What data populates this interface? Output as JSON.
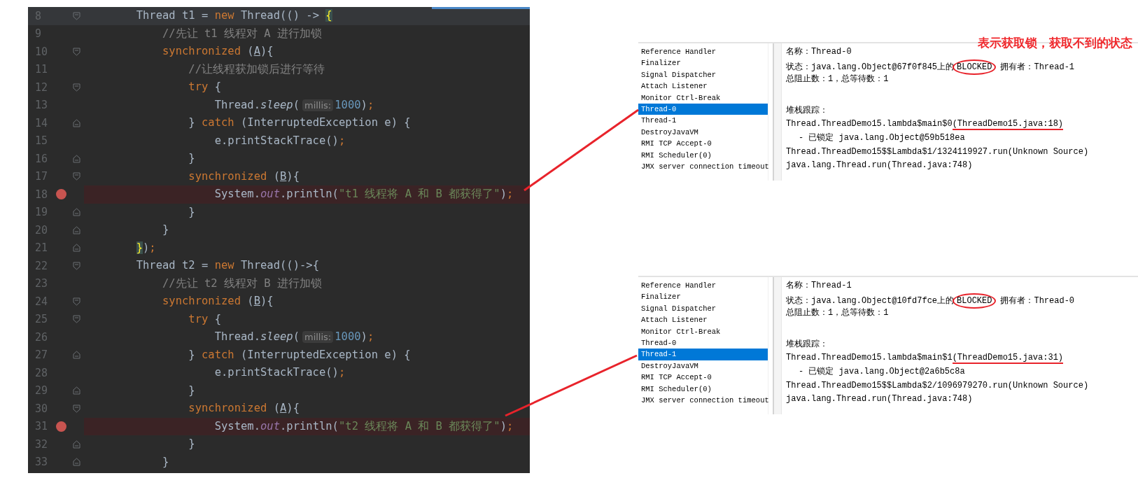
{
  "editor": {
    "lines": [
      {
        "number": "8",
        "current": true,
        "breakpoint": false,
        "fold_start": true,
        "fold_end": false,
        "tokens": [
          {
            "kind": "plain",
            "text": "        Thread t1 = "
          },
          {
            "kind": "keyword",
            "text": "new"
          },
          {
            "kind": "plain",
            "text": " Thread(() -> "
          },
          {
            "kind": "brace",
            "text": "{"
          }
        ]
      },
      {
        "number": "9",
        "current": false,
        "breakpoint": false,
        "fold_start": false,
        "fold_end": false,
        "tokens": [
          {
            "kind": "comment",
            "text": "            //先让 t1 线程对 A 进行加锁"
          }
        ]
      },
      {
        "number": "10",
        "current": false,
        "breakpoint": false,
        "fold_start": true,
        "fold_end": false,
        "tokens": [
          {
            "kind": "keyword",
            "text": "            synchronized"
          },
          {
            "kind": "plain",
            "text": " ("
          },
          {
            "kind": "ref",
            "text": "A"
          },
          {
            "kind": "plain",
            "text": "){"
          }
        ]
      },
      {
        "number": "11",
        "current": false,
        "breakpoint": false,
        "fold_start": false,
        "fold_end": false,
        "tokens": [
          {
            "kind": "comment",
            "text": "                //让线程获加锁后进行等待"
          }
        ]
      },
      {
        "number": "12",
        "current": false,
        "breakpoint": false,
        "fold_start": true,
        "fold_end": false,
        "tokens": [
          {
            "kind": "keyword",
            "text": "                try"
          },
          {
            "kind": "plain",
            "text": " {"
          }
        ]
      },
      {
        "number": "13",
        "current": false,
        "breakpoint": false,
        "fold_start": false,
        "fold_end": false,
        "tokens": [
          {
            "kind": "plain",
            "text": "                    Thread."
          },
          {
            "kind": "static",
            "text": "sleep"
          },
          {
            "kind": "plain",
            "text": "("
          },
          {
            "kind": "hint",
            "text": "millis:"
          },
          {
            "kind": "number",
            "text": "1000"
          },
          {
            "kind": "plain",
            "text": ")"
          },
          {
            "kind": "keyword",
            "text": ";"
          }
        ]
      },
      {
        "number": "14",
        "current": false,
        "breakpoint": false,
        "fold_start": false,
        "fold_end": true,
        "tokens": [
          {
            "kind": "plain",
            "text": "                } "
          },
          {
            "kind": "keyword",
            "text": "catch"
          },
          {
            "kind": "plain",
            "text": " (InterruptedException e) {"
          }
        ]
      },
      {
        "number": "15",
        "current": false,
        "breakpoint": false,
        "fold_start": false,
        "fold_end": false,
        "tokens": [
          {
            "kind": "plain",
            "text": "                    e.printStackTrace()"
          },
          {
            "kind": "keyword",
            "text": ";"
          }
        ]
      },
      {
        "number": "16",
        "current": false,
        "breakpoint": false,
        "fold_start": false,
        "fold_end": true,
        "tokens": [
          {
            "kind": "plain",
            "text": "                }"
          }
        ]
      },
      {
        "number": "17",
        "current": false,
        "breakpoint": false,
        "fold_start": true,
        "fold_end": false,
        "tokens": [
          {
            "kind": "keyword",
            "text": "                synchronized"
          },
          {
            "kind": "plain",
            "text": " ("
          },
          {
            "kind": "ref",
            "text": "B"
          },
          {
            "kind": "plain",
            "text": "){"
          }
        ]
      },
      {
        "number": "18",
        "current": false,
        "breakpoint": true,
        "fold_start": false,
        "fold_end": false,
        "tokens": [
          {
            "kind": "plain",
            "text": "                    System."
          },
          {
            "kind": "field",
            "text": "out"
          },
          {
            "kind": "plain",
            "text": ".println("
          },
          {
            "kind": "string",
            "text": "\"t1 线程将 A 和 B 都获得了\""
          },
          {
            "kind": "plain",
            "text": ")"
          },
          {
            "kind": "keyword",
            "text": ";"
          }
        ]
      },
      {
        "number": "19",
        "current": false,
        "breakpoint": false,
        "fold_start": false,
        "fold_end": true,
        "tokens": [
          {
            "kind": "plain",
            "text": "                }"
          }
        ]
      },
      {
        "number": "20",
        "current": false,
        "breakpoint": false,
        "fold_start": false,
        "fold_end": true,
        "tokens": [
          {
            "kind": "plain",
            "text": "            }"
          }
        ]
      },
      {
        "number": "21",
        "current": false,
        "breakpoint": false,
        "fold_start": false,
        "fold_end": true,
        "tokens": [
          {
            "kind": "brace",
            "text": "        }"
          },
          {
            "kind": "plain",
            "text": ")"
          },
          {
            "kind": "keyword",
            "text": ";"
          }
        ]
      },
      {
        "number": "22",
        "current": false,
        "breakpoint": false,
        "fold_start": true,
        "fold_end": false,
        "tokens": [
          {
            "kind": "plain",
            "text": "        Thread t2 = "
          },
          {
            "kind": "keyword",
            "text": "new"
          },
          {
            "kind": "plain",
            "text": " Thread(()->{"
          }
        ]
      },
      {
        "number": "23",
        "current": false,
        "breakpoint": false,
        "fold_start": false,
        "fold_end": false,
        "tokens": [
          {
            "kind": "comment",
            "text": "            //先让 t2 线程对 B 进行加锁"
          }
        ]
      },
      {
        "number": "24",
        "current": false,
        "breakpoint": false,
        "fold_start": true,
        "fold_end": false,
        "tokens": [
          {
            "kind": "keyword",
            "text": "            synchronized"
          },
          {
            "kind": "plain",
            "text": " ("
          },
          {
            "kind": "ref",
            "text": "B"
          },
          {
            "kind": "plain",
            "text": "){"
          }
        ]
      },
      {
        "number": "25",
        "current": false,
        "breakpoint": false,
        "fold_start": true,
        "fold_end": false,
        "tokens": [
          {
            "kind": "keyword",
            "text": "                try"
          },
          {
            "kind": "plain",
            "text": " {"
          }
        ]
      },
      {
        "number": "26",
        "current": false,
        "breakpoint": false,
        "fold_start": false,
        "fold_end": false,
        "tokens": [
          {
            "kind": "plain",
            "text": "                    Thread."
          },
          {
            "kind": "static",
            "text": "sleep"
          },
          {
            "kind": "plain",
            "text": "("
          },
          {
            "kind": "hint",
            "text": "millis:"
          },
          {
            "kind": "number",
            "text": "1000"
          },
          {
            "kind": "plain",
            "text": ")"
          },
          {
            "kind": "keyword",
            "text": ";"
          }
        ]
      },
      {
        "number": "27",
        "current": false,
        "breakpoint": false,
        "fold_start": false,
        "fold_end": true,
        "tokens": [
          {
            "kind": "plain",
            "text": "                } "
          },
          {
            "kind": "keyword",
            "text": "catch"
          },
          {
            "kind": "plain",
            "text": " (InterruptedException e) {"
          }
        ]
      },
      {
        "number": "28",
        "current": false,
        "breakpoint": false,
        "fold_start": false,
        "fold_end": false,
        "tokens": [
          {
            "kind": "plain",
            "text": "                    e.printStackTrace()"
          },
          {
            "kind": "keyword",
            "text": ";"
          }
        ]
      },
      {
        "number": "29",
        "current": false,
        "breakpoint": false,
        "fold_start": false,
        "fold_end": true,
        "tokens": [
          {
            "kind": "plain",
            "text": "                }"
          }
        ]
      },
      {
        "number": "30",
        "current": false,
        "breakpoint": false,
        "fold_start": true,
        "fold_end": false,
        "tokens": [
          {
            "kind": "keyword",
            "text": "                synchronized"
          },
          {
            "kind": "plain",
            "text": " ("
          },
          {
            "kind": "ref",
            "text": "A"
          },
          {
            "kind": "plain",
            "text": "){"
          }
        ]
      },
      {
        "number": "31",
        "current": false,
        "breakpoint": true,
        "fold_start": false,
        "fold_end": false,
        "tokens": [
          {
            "kind": "plain",
            "text": "                    System."
          },
          {
            "kind": "field",
            "text": "out"
          },
          {
            "kind": "plain",
            "text": ".println("
          },
          {
            "kind": "string",
            "text": "\"t2 线程将 A 和 B 都获得了\""
          },
          {
            "kind": "plain",
            "text": ")"
          },
          {
            "kind": "keyword",
            "text": ";"
          }
        ]
      },
      {
        "number": "32",
        "current": false,
        "breakpoint": false,
        "fold_start": false,
        "fold_end": true,
        "tokens": [
          {
            "kind": "plain",
            "text": "                }"
          }
        ]
      },
      {
        "number": "33",
        "current": false,
        "breakpoint": false,
        "fold_start": false,
        "fold_end": true,
        "tokens": [
          {
            "kind": "plain",
            "text": "            }"
          }
        ]
      }
    ]
  },
  "annotation": "表示获取锁，获取不到的状态",
  "thread_panels": [
    {
      "threads": [
        {
          "name": "Reference Handler",
          "selected": false
        },
        {
          "name": "Finalizer",
          "selected": false
        },
        {
          "name": "Signal Dispatcher",
          "selected": false
        },
        {
          "name": "Attach Listener",
          "selected": false
        },
        {
          "name": "Monitor Ctrl-Break",
          "selected": false
        },
        {
          "name": "Thread-0",
          "selected": true
        },
        {
          "name": "Thread-1",
          "selected": false
        },
        {
          "name": "DestroyJavaVM",
          "selected": false
        },
        {
          "name": "RMI TCP Accept-0",
          "selected": false
        },
        {
          "name": "RMI Scheduler(0)",
          "selected": false
        },
        {
          "name": "JMX server connection timeout",
          "selected": false
        }
      ],
      "details": {
        "name_label": "名称：",
        "name": "Thread-0",
        "state_label": "状态：",
        "state_object": "java.lang.Object@67f0f845上的",
        "state": "BLOCKED",
        "state_circled": true,
        "owner_label": "拥有者：",
        "owner": "Thread-1",
        "counts": "总阻止数：1，总等待数：1",
        "stack_label": "堆栈跟踪：",
        "stack": [
          {
            "kind": "frame",
            "text": "Thread.ThreadDemo15.lambda$main$0",
            "source": "(ThreadDemo15.java:18)",
            "underlined": true
          },
          {
            "kind": "lock",
            "text": "- 已锁定 java.lang.Object@59b518ea"
          },
          {
            "kind": "frame",
            "text": "Thread.ThreadDemo15$$Lambda$1/1324119927.run",
            "source": "(Unknown Source)",
            "underlined": false
          },
          {
            "kind": "frame",
            "text": "java.lang.Thread.run",
            "source": "(Thread.java:748)",
            "underlined": false
          }
        ]
      }
    },
    {
      "threads": [
        {
          "name": "Reference Handler",
          "selected": false
        },
        {
          "name": "Finalizer",
          "selected": false
        },
        {
          "name": "Signal Dispatcher",
          "selected": false
        },
        {
          "name": "Attach Listener",
          "selected": false
        },
        {
          "name": "Monitor Ctrl-Break",
          "selected": false
        },
        {
          "name": "Thread-0",
          "selected": false
        },
        {
          "name": "Thread-1",
          "selected": true
        },
        {
          "name": "DestroyJavaVM",
          "selected": false
        },
        {
          "name": "RMI TCP Accept-0",
          "selected": false
        },
        {
          "name": "RMI Scheduler(0)",
          "selected": false
        },
        {
          "name": "JMX server connection timeout",
          "selected": false
        }
      ],
      "details": {
        "name_label": "名称：",
        "name": "Thread-1",
        "state_label": "状态：",
        "state_object": "java.lang.Object@10fd7fce上的",
        "state": "BLOCKED",
        "state_circled": true,
        "owner_label": "拥有者：",
        "owner": "Thread-0",
        "counts": "总阻止数：1，总等待数：1",
        "stack_label": "堆栈跟踪：",
        "stack": [
          {
            "kind": "frame",
            "text": "Thread.ThreadDemo15.lambda$main$1",
            "source": "(ThreadDemo15.java:31)",
            "underlined": true
          },
          {
            "kind": "lock",
            "text": "- 已锁定 java.lang.Object@2a6b5c8a"
          },
          {
            "kind": "frame",
            "text": "Thread.ThreadDemo15$$Lambda$2/1096979270.run",
            "source": "(Unknown Source)",
            "underlined": false
          },
          {
            "kind": "frame",
            "text": "java.lang.Thread.run",
            "source": "(Thread.java:748)",
            "underlined": false
          }
        ]
      }
    }
  ]
}
